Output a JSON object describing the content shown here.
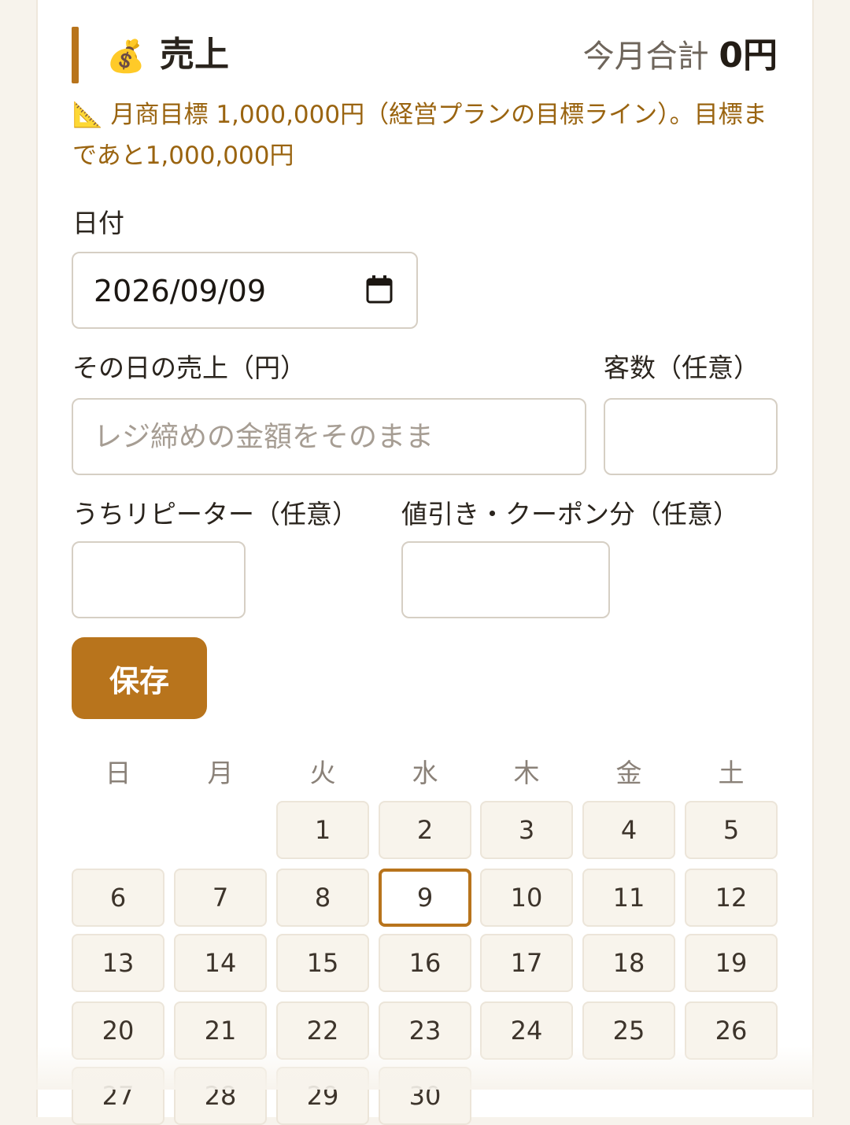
{
  "section": {
    "icon": "money-bag-icon",
    "icon_glyph": "💰",
    "title": "売上",
    "month_total_label": "今月合計",
    "month_total_value": "0円"
  },
  "goal": {
    "icon_glyph": "📐",
    "text": "月商目標 1,000,000円（経営プランの目標ライン）。目標まであと1,000,000円"
  },
  "date_field": {
    "label": "日付",
    "value": "2026/09/09"
  },
  "sales_field": {
    "label": "その日の売上（円）",
    "placeholder": "レジ締めの金額をそのまま"
  },
  "customers_field": {
    "label": "客数（任意）",
    "value": ""
  },
  "repeaters_field": {
    "label": "うちリピーター（任意）",
    "value": ""
  },
  "discount_field": {
    "label": "値引き・クーポン分（任意）",
    "value": ""
  },
  "save_button": {
    "label": "保存"
  },
  "calendar": {
    "weekdays": [
      "日",
      "月",
      "火",
      "水",
      "木",
      "金",
      "土"
    ],
    "first_weekday_index": 2,
    "days": [
      "1",
      "2",
      "3",
      "4",
      "5",
      "6",
      "7",
      "8",
      "9",
      "10",
      "11",
      "12",
      "13",
      "14",
      "15",
      "16",
      "17",
      "18",
      "19",
      "20",
      "21",
      "22",
      "23",
      "24",
      "25",
      "26",
      "27",
      "28",
      "29",
      "30"
    ],
    "selected_day": "9"
  },
  "colors": {
    "accent": "#b8741c",
    "goal_text": "#9a6410"
  }
}
